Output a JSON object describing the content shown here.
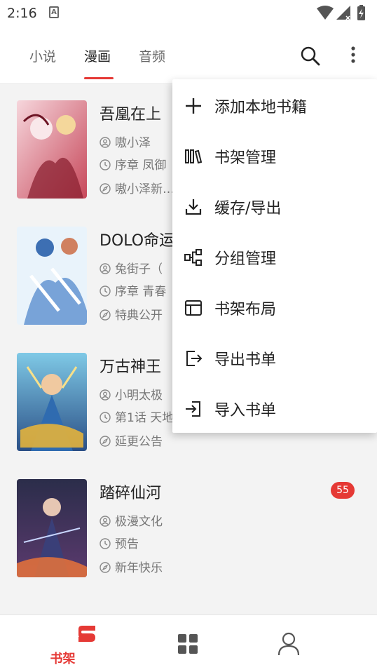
{
  "status_bar": {
    "time": "2:16",
    "notification_glyph": "A"
  },
  "tabs": [
    {
      "label": "小说",
      "active": false
    },
    {
      "label": "漫画",
      "active": true
    },
    {
      "label": "音频",
      "active": false
    }
  ],
  "books": [
    {
      "title": "吾凰在上",
      "author": "嗷小泽",
      "chapter": "序章 凤御",
      "note": "嗷小泽新…",
      "badge": ""
    },
    {
      "title": "DOLO命运",
      "author": "兔街子（",
      "chapter": "序章 青春",
      "note": "特典公开",
      "badge": ""
    },
    {
      "title": "万古神王",
      "author": "小明太极",
      "chapter": "第1话 天地",
      "note": "延更公告",
      "badge": ""
    },
    {
      "title": "踏碎仙河",
      "author": "极漫文化",
      "chapter": "预告",
      "note": "新年快乐",
      "badge": "55"
    }
  ],
  "menu": {
    "items": [
      {
        "label": "添加本地书籍",
        "icon": "plus-icon"
      },
      {
        "label": "书架管理",
        "icon": "bookshelf-icon"
      },
      {
        "label": "缓存/导出",
        "icon": "download-icon"
      },
      {
        "label": "分组管理",
        "icon": "group-icon"
      },
      {
        "label": "书架布局",
        "icon": "layout-icon"
      },
      {
        "label": "导出书单",
        "icon": "export-icon"
      },
      {
        "label": "导入书单",
        "icon": "import-icon"
      }
    ]
  },
  "bottom_nav": {
    "items": [
      {
        "label": "书架",
        "icon": "bookshelf-logo-icon",
        "active": true
      },
      {
        "label": "",
        "icon": "discover-grid-icon",
        "active": false
      },
      {
        "label": "",
        "icon": "profile-icon",
        "active": false
      }
    ]
  },
  "colors": {
    "accent": "#e53935",
    "background": "#f3f3f3",
    "text": "#222222",
    "muted": "#777777"
  }
}
